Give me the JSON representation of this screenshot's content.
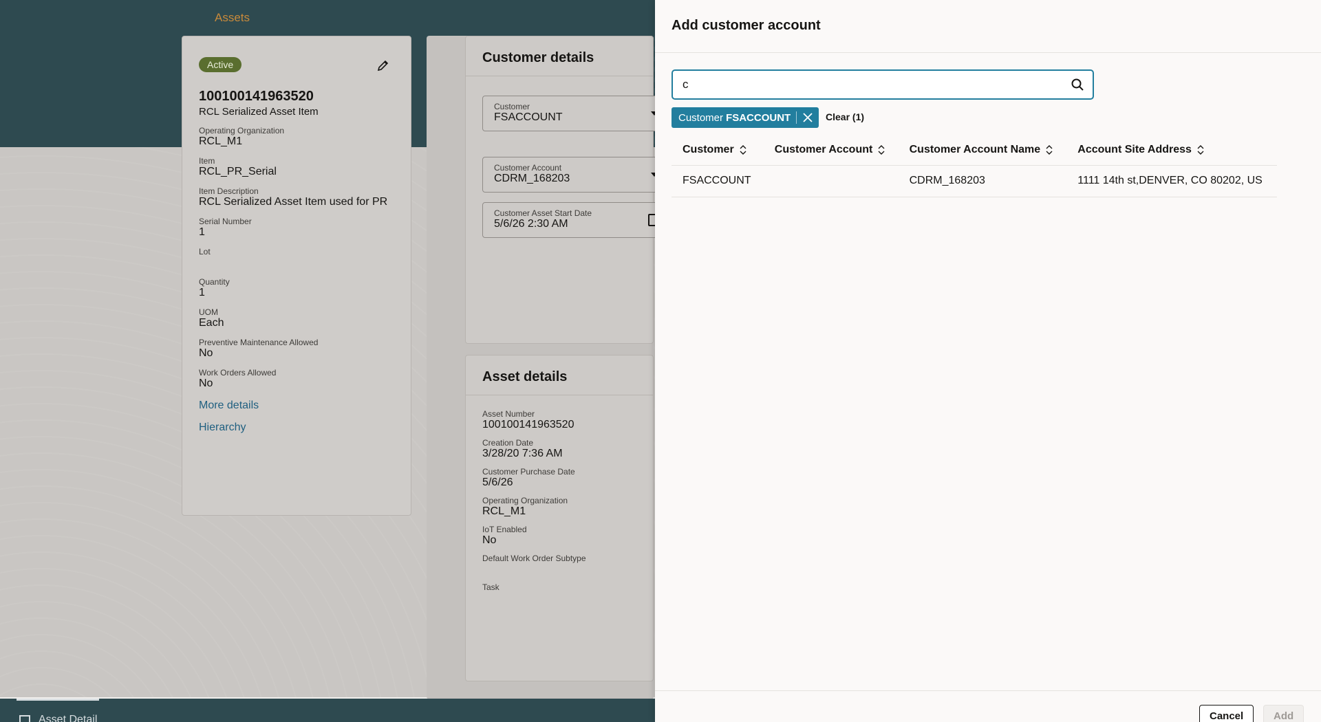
{
  "header": {
    "assets_link": "Assets"
  },
  "summary": {
    "status": "Active",
    "asset_number": "100100141963520",
    "asset_item": "RCL Serialized Asset Item",
    "fields": [
      {
        "label": "Operating Organization",
        "value": "RCL_M1"
      },
      {
        "label": "Item",
        "value": "RCL_PR_Serial"
      },
      {
        "label": "Item Description",
        "value": "RCL Serialized Asset Item used for PR"
      },
      {
        "label": "Serial Number",
        "value": "1"
      },
      {
        "label": "Lot",
        "value": ""
      },
      {
        "label": "Quantity",
        "value": "1"
      },
      {
        "label": "UOM",
        "value": "Each"
      },
      {
        "label": "Preventive Maintenance Allowed",
        "value": "No"
      },
      {
        "label": "Work Orders Allowed",
        "value": "No"
      }
    ],
    "links": {
      "more_details": "More details",
      "hierarchy": "Hierarchy"
    }
  },
  "customer_details": {
    "title": "Customer details",
    "customer": {
      "label": "Customer",
      "value": "FSACCOUNT"
    },
    "customer_account": {
      "label": "Customer Account",
      "value": "CDRM_168203"
    },
    "start_date": {
      "label": "Customer Asset Start Date",
      "value": "5/6/26 2:30 AM"
    }
  },
  "asset_details": {
    "title": "Asset details",
    "fields": [
      {
        "label": "Asset Number",
        "value": "100100141963520"
      },
      {
        "label": "Creation Date",
        "value": "3/28/20 7:36 AM"
      },
      {
        "label": "Customer Purchase Date",
        "value": "5/6/26"
      },
      {
        "label": "Operating Organization",
        "value": "RCL_M1"
      },
      {
        "label": "IoT Enabled",
        "value": "No"
      },
      {
        "label": "Default Work Order Subtype",
        "value": ""
      },
      {
        "label": "Task",
        "value": ""
      }
    ]
  },
  "bottom_tab": {
    "label": "Asset Detail"
  },
  "drawer": {
    "title": "Add customer account",
    "search_value": "c",
    "filter_chip": {
      "label": "Customer",
      "value": "FSACCOUNT"
    },
    "clear_label": "Clear (1)",
    "columns": [
      "Customer",
      "Customer Account",
      "Customer Account Name",
      "Account Site Address"
    ],
    "rows": [
      [
        "FSACCOUNT",
        "",
        "CDRM_168203",
        "1111 14th st,DENVER, CO 80202, US"
      ]
    ],
    "cancel_label": "Cancel",
    "add_label": "Add"
  },
  "icons": {
    "edit": "pencil-icon",
    "search": "search-icon",
    "chip_close": "close-icon",
    "sort": "sort-icon",
    "calendar": "calendar-icon",
    "dropdown": "chevron-down-icon"
  },
  "colors": {
    "accent": "#227e9e",
    "header_bg": "#2e4a50",
    "status_active": "#5a6e2f",
    "link": "#1f5f80"
  }
}
